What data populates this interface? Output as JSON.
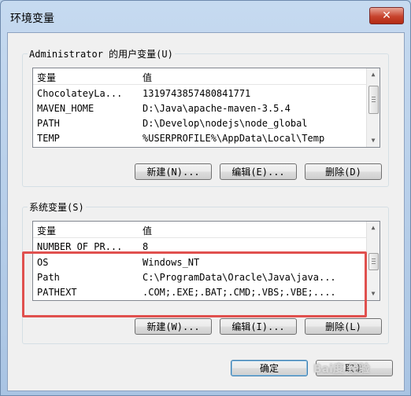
{
  "window": {
    "title": "环境变量",
    "close_label": "✕"
  },
  "user_vars": {
    "label": "Administrator 的用户变量(U)",
    "header": {
      "name": "变量",
      "value": "值"
    },
    "rows": [
      {
        "name": "ChocolateyLa...",
        "value": "1319743857480841771"
      },
      {
        "name": "MAVEN_HOME",
        "value": "D:\\Java\\apache-maven-3.5.4"
      },
      {
        "name": "PATH",
        "value": "D:\\Develop\\nodejs\\node_global"
      },
      {
        "name": "TEMP",
        "value": "%USERPROFILE%\\AppData\\Local\\Temp"
      }
    ],
    "buttons": {
      "new": "新建(N)...",
      "edit": "编辑(E)...",
      "delete": "删除(D)"
    }
  },
  "system_vars": {
    "label": "系统变量(S)",
    "header": {
      "name": "变量",
      "value": "值"
    },
    "rows": [
      {
        "name": "NUMBER_OF_PR...",
        "value": "8"
      },
      {
        "name": "OS",
        "value": "Windows_NT"
      },
      {
        "name": "Path",
        "value": "C:\\ProgramData\\Oracle\\Java\\java..."
      },
      {
        "name": "PATHEXT",
        "value": ".COM;.EXE;.BAT;.CMD;.VBS;.VBE;...."
      }
    ],
    "buttons": {
      "new": "新建(W)...",
      "edit": "编辑(I)...",
      "delete": "删除(L)"
    }
  },
  "dialog_buttons": {
    "ok": "确定",
    "cancel": "取消"
  },
  "watermark": "Bai度 经验",
  "colors": {
    "highlight": "#e0504e",
    "title_bg": "#b9d1ea"
  }
}
